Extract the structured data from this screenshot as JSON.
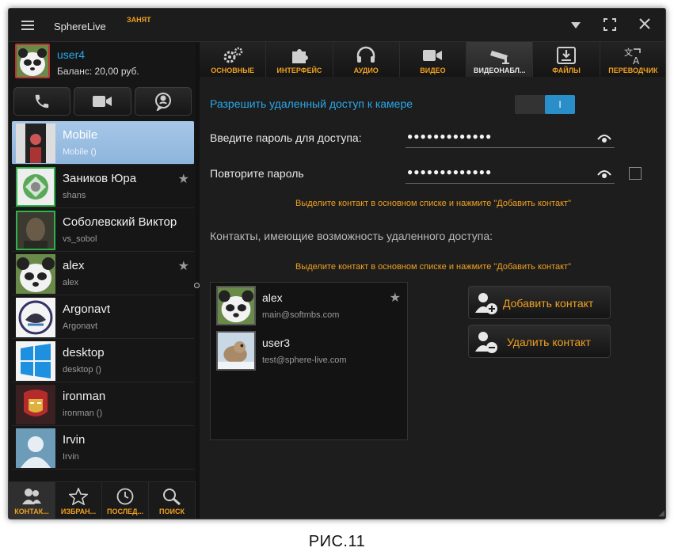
{
  "window": {
    "app_title": "SphereLive",
    "status": "ЗАНЯТ"
  },
  "me": {
    "name": "user4",
    "balance": "Баланс: 20,00 руб."
  },
  "contacts": [
    {
      "name": "Mobile",
      "sub": "Mobile ()",
      "starred": false
    },
    {
      "name": "Заников Юра",
      "sub": "shans",
      "starred": true
    },
    {
      "name": "Соболевский Виктор",
      "sub": "vs_sobol",
      "starred": false
    },
    {
      "name": "alex",
      "sub": "alex",
      "starred": true
    },
    {
      "name": "Argonavt",
      "sub": "Argonavt",
      "starred": false
    },
    {
      "name": "desktop",
      "sub": "desktop ()",
      "starred": false
    },
    {
      "name": "ironman",
      "sub": "ironman ()",
      "starred": false
    },
    {
      "name": "Irvin",
      "sub": "Irvin",
      "starred": false
    }
  ],
  "left_tabs": [
    {
      "label": "КОНТАК...",
      "icon": "contacts-icon"
    },
    {
      "label": "ИЗБРАН...",
      "icon": "star-icon"
    },
    {
      "label": "ПОСЛЕД...",
      "icon": "clock-icon"
    },
    {
      "label": "ПОИСК",
      "icon": "search-icon"
    }
  ],
  "tabs": [
    {
      "label": "ОСНОВНЫЕ",
      "icon": "gears-icon"
    },
    {
      "label": "ИНТЕРФЕЙС",
      "icon": "puzzle-icon"
    },
    {
      "label": "АУДИО",
      "icon": "headset-icon"
    },
    {
      "label": "ВИДЕО",
      "icon": "video-camera-icon"
    },
    {
      "label": "ВИДЕОНАБЛ...",
      "icon": "cctv-icon"
    },
    {
      "label": "ФАЙЛЫ",
      "icon": "download-icon"
    },
    {
      "label": "ПЕРЕВОДЧИК",
      "icon": "translate-icon"
    }
  ],
  "active_tab": 4,
  "settings": {
    "allow_label": "Разрешить удаленный доступ к камере",
    "toggle_text": "I",
    "password_label": "Введите пароль для доступа:",
    "password_value": "●●●●●●●●●●●●●",
    "repeat_label": "Повторите пароль",
    "repeat_value": "●●●●●●●●●●●●●",
    "hint1": "Выделите контакт в основном списке и нажмите \"Добавить контакт\"",
    "section_label": "Контакты, имеющие возможность удаленного доступа:",
    "hint2": "Выделите контакт в основном списке и нажмите \"Добавить контакт\""
  },
  "access_contacts": [
    {
      "name": "alex",
      "sub": "main@softmbs.com",
      "starred": true
    },
    {
      "name": "user3",
      "sub": "test@sphere-live.com",
      "starred": false
    }
  ],
  "buttons": {
    "add": "Добавить контакт",
    "remove": "Удалить контакт"
  },
  "caption": "РИС.11",
  "colors": {
    "accent": "#f0a020",
    "link": "#2aa8e8",
    "toggle": "#2a8fc9",
    "online": "#2fb34a"
  }
}
